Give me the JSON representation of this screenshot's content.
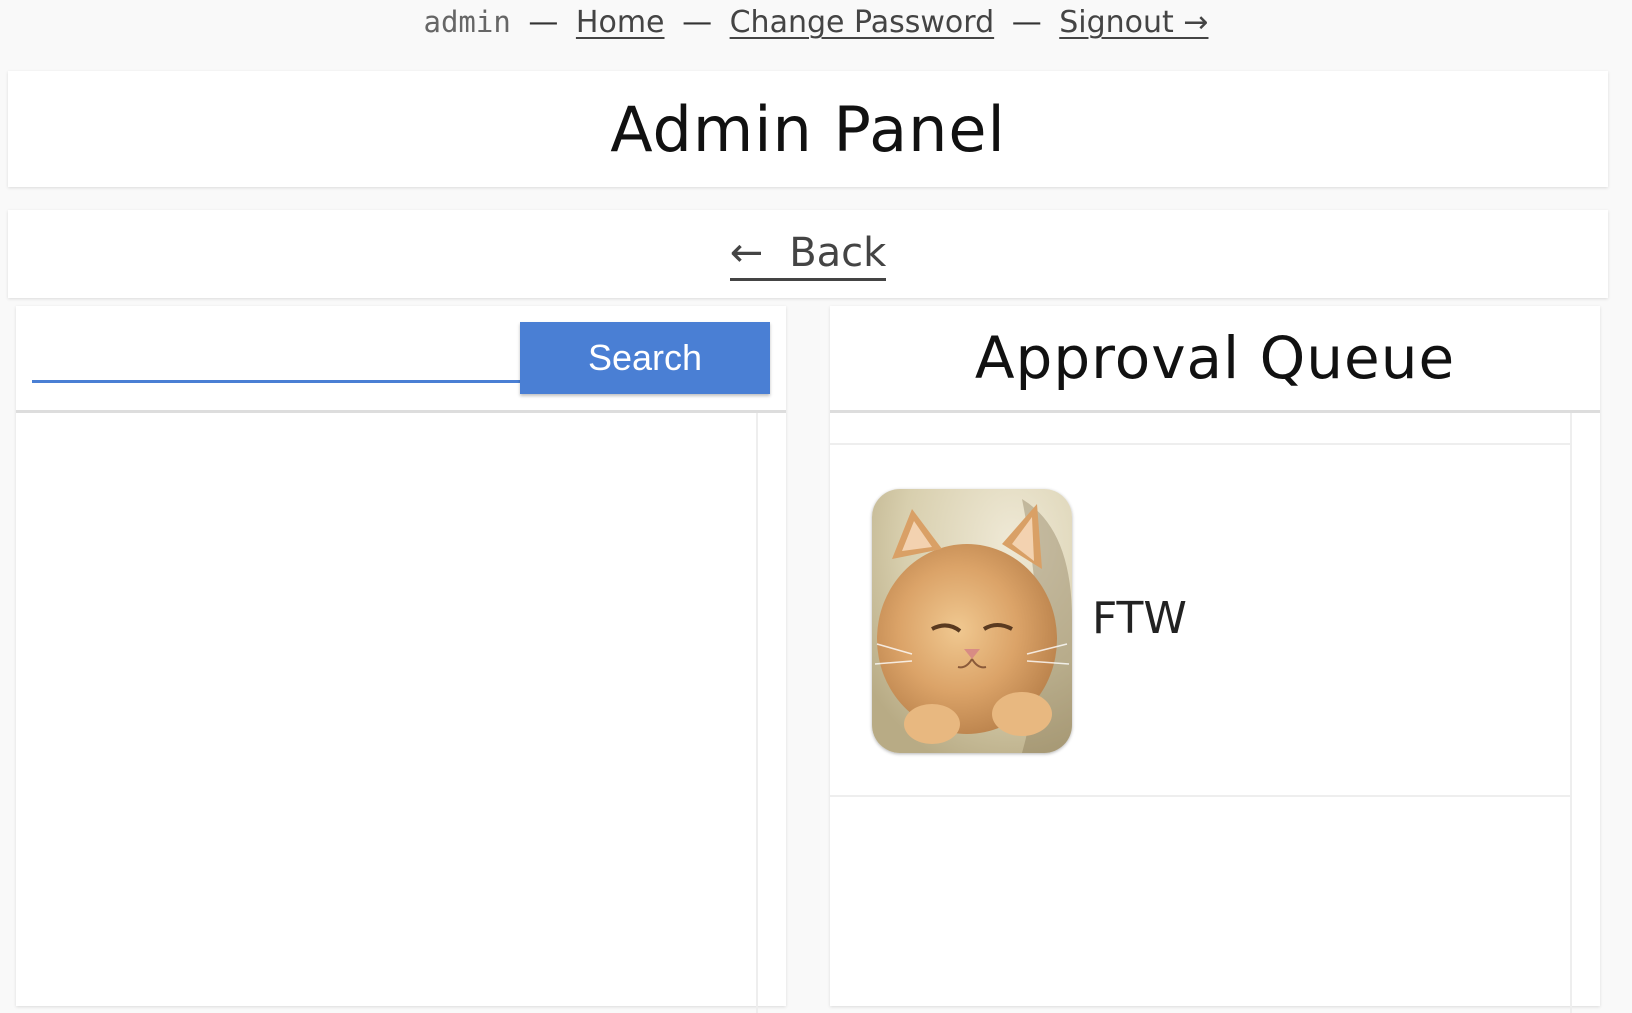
{
  "nav": {
    "username": "admin",
    "separator": "—",
    "home": "Home",
    "change_password": "Change Password",
    "signout": "Signout →"
  },
  "header": {
    "title": "Admin Panel"
  },
  "back": {
    "arrow": "←",
    "label": "Back"
  },
  "search": {
    "value": "",
    "placeholder": "",
    "button_label": "Search"
  },
  "queue": {
    "title": "Approval Queue",
    "items": [
      {
        "label": "FTW",
        "thumbnail": "cat-photo"
      }
    ]
  },
  "colors": {
    "accent": "#4a7fd4",
    "background": "#f9f9f9"
  }
}
